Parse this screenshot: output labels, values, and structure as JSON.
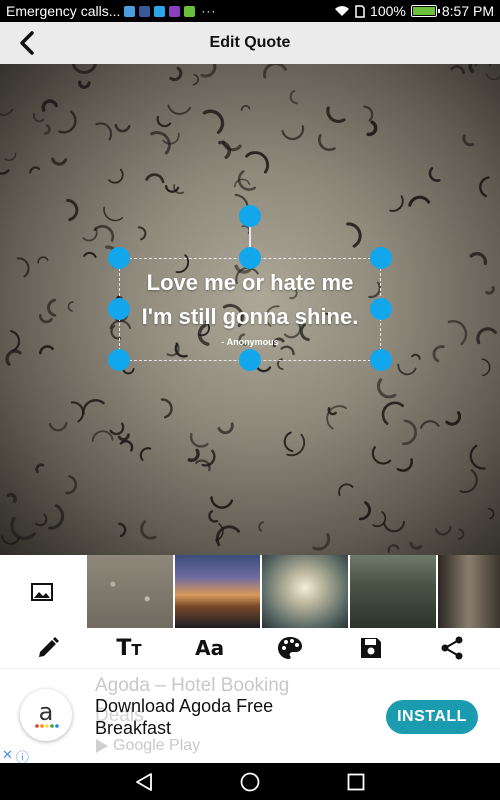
{
  "status_bar": {
    "notification_text": "Emergency calls...",
    "overflow": "···",
    "battery": "100%",
    "time": "8:57 PM",
    "notif_icon_colors": [
      "#4a9ee0",
      "#3b5998",
      "#2aa7e8",
      "#8a3fbf",
      "#6abf3b"
    ]
  },
  "header": {
    "title": "Edit Quote",
    "back_icon": "chevron-left-icon"
  },
  "quote": {
    "lines": [
      "Love me or hate me",
      "I'm still gonna shine."
    ],
    "author": "- Anonymous"
  },
  "colors": {
    "handle": "#12a6ec",
    "install_button": "#1b9bb0",
    "header_bg": "#ebebeb"
  },
  "thumbnails": {
    "gallery_icon": "image-icon",
    "items": [
      "raindrops",
      "sunset",
      "clouds",
      "road",
      "forest"
    ]
  },
  "toolbar": {
    "tools": [
      "pencil-icon",
      "text-size-icon",
      "font-icon",
      "palette-icon",
      "save-icon",
      "share-icon"
    ],
    "text_size_glyph_big": "T",
    "text_size_glyph_small": "T",
    "font_glyph": "Aa"
  },
  "ad": {
    "faded_title": "Agoda – Hotel Booking",
    "faded_title2": "Deals",
    "headline": "Download Agoda Free Breakfast",
    "store": "Google Play",
    "install_label": "INSTALL",
    "logo_letter": "a"
  },
  "nav_bar": {
    "buttons": [
      "back-triangle-icon",
      "home-circle-icon",
      "recents-square-icon"
    ]
  }
}
